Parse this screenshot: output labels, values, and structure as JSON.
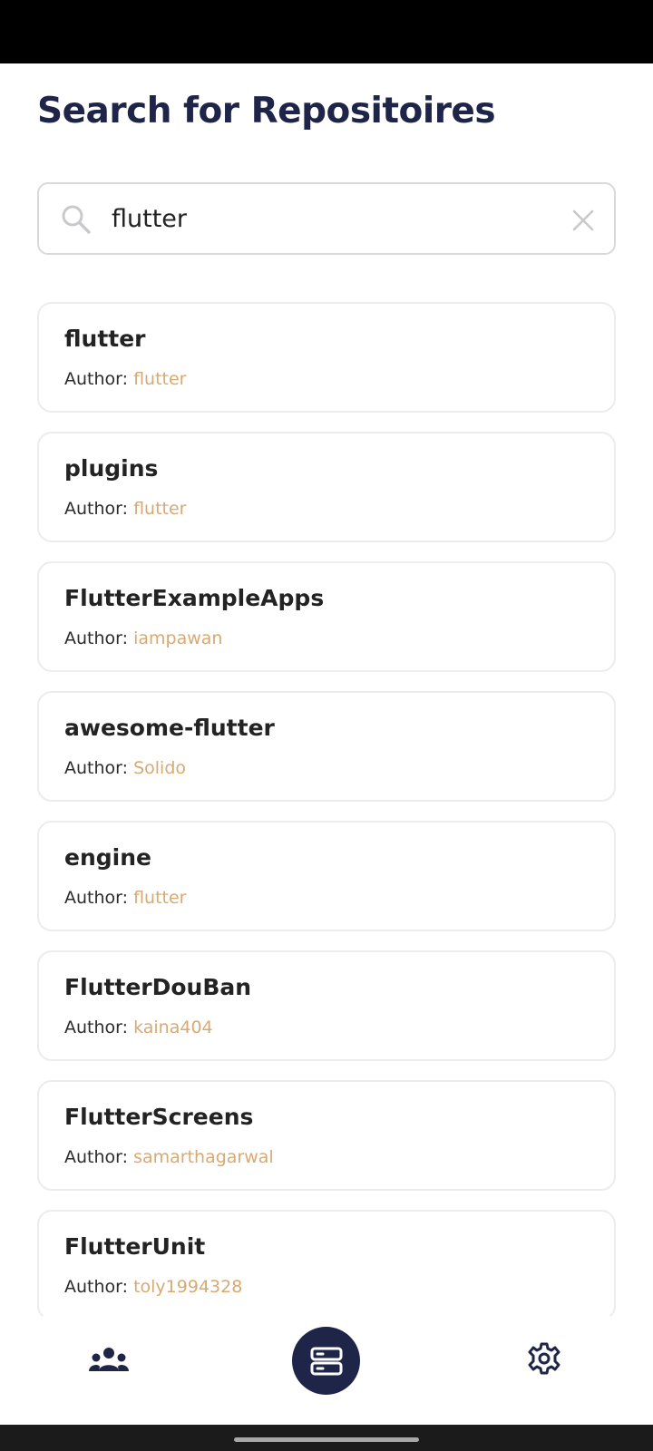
{
  "page": {
    "title": "Search for Repositoires"
  },
  "search": {
    "value": "flutter",
    "placeholder": "",
    "icon": "search-icon",
    "clear_icon": "close-icon"
  },
  "repositories": [
    {
      "name": "flutter",
      "author_label": "Author: ",
      "author": "flutter"
    },
    {
      "name": "plugins",
      "author_label": "Author: ",
      "author": "flutter"
    },
    {
      "name": "FlutterExampleApps",
      "author_label": "Author: ",
      "author": "iampawan"
    },
    {
      "name": "awesome-flutter",
      "author_label": "Author: ",
      "author": "Solido"
    },
    {
      "name": "engine",
      "author_label": "Author: ",
      "author": "flutter"
    },
    {
      "name": "FlutterDouBan",
      "author_label": "Author: ",
      "author": "kaina404"
    },
    {
      "name": "FlutterScreens",
      "author_label": "Author: ",
      "author": "samarthagarwal"
    },
    {
      "name": "FlutterUnit",
      "author_label": "Author: ",
      "author": "toly1994328"
    }
  ],
  "bottom_nav": {
    "items": [
      {
        "icon": "users-icon",
        "active": false
      },
      {
        "icon": "repositories-icon",
        "active": true
      },
      {
        "icon": "gear-icon",
        "active": false
      }
    ]
  },
  "colors": {
    "title": "#1e2548",
    "author_accent": "#d8a972",
    "nav_active_bg": "#1e2548",
    "card_border": "#ececef"
  }
}
